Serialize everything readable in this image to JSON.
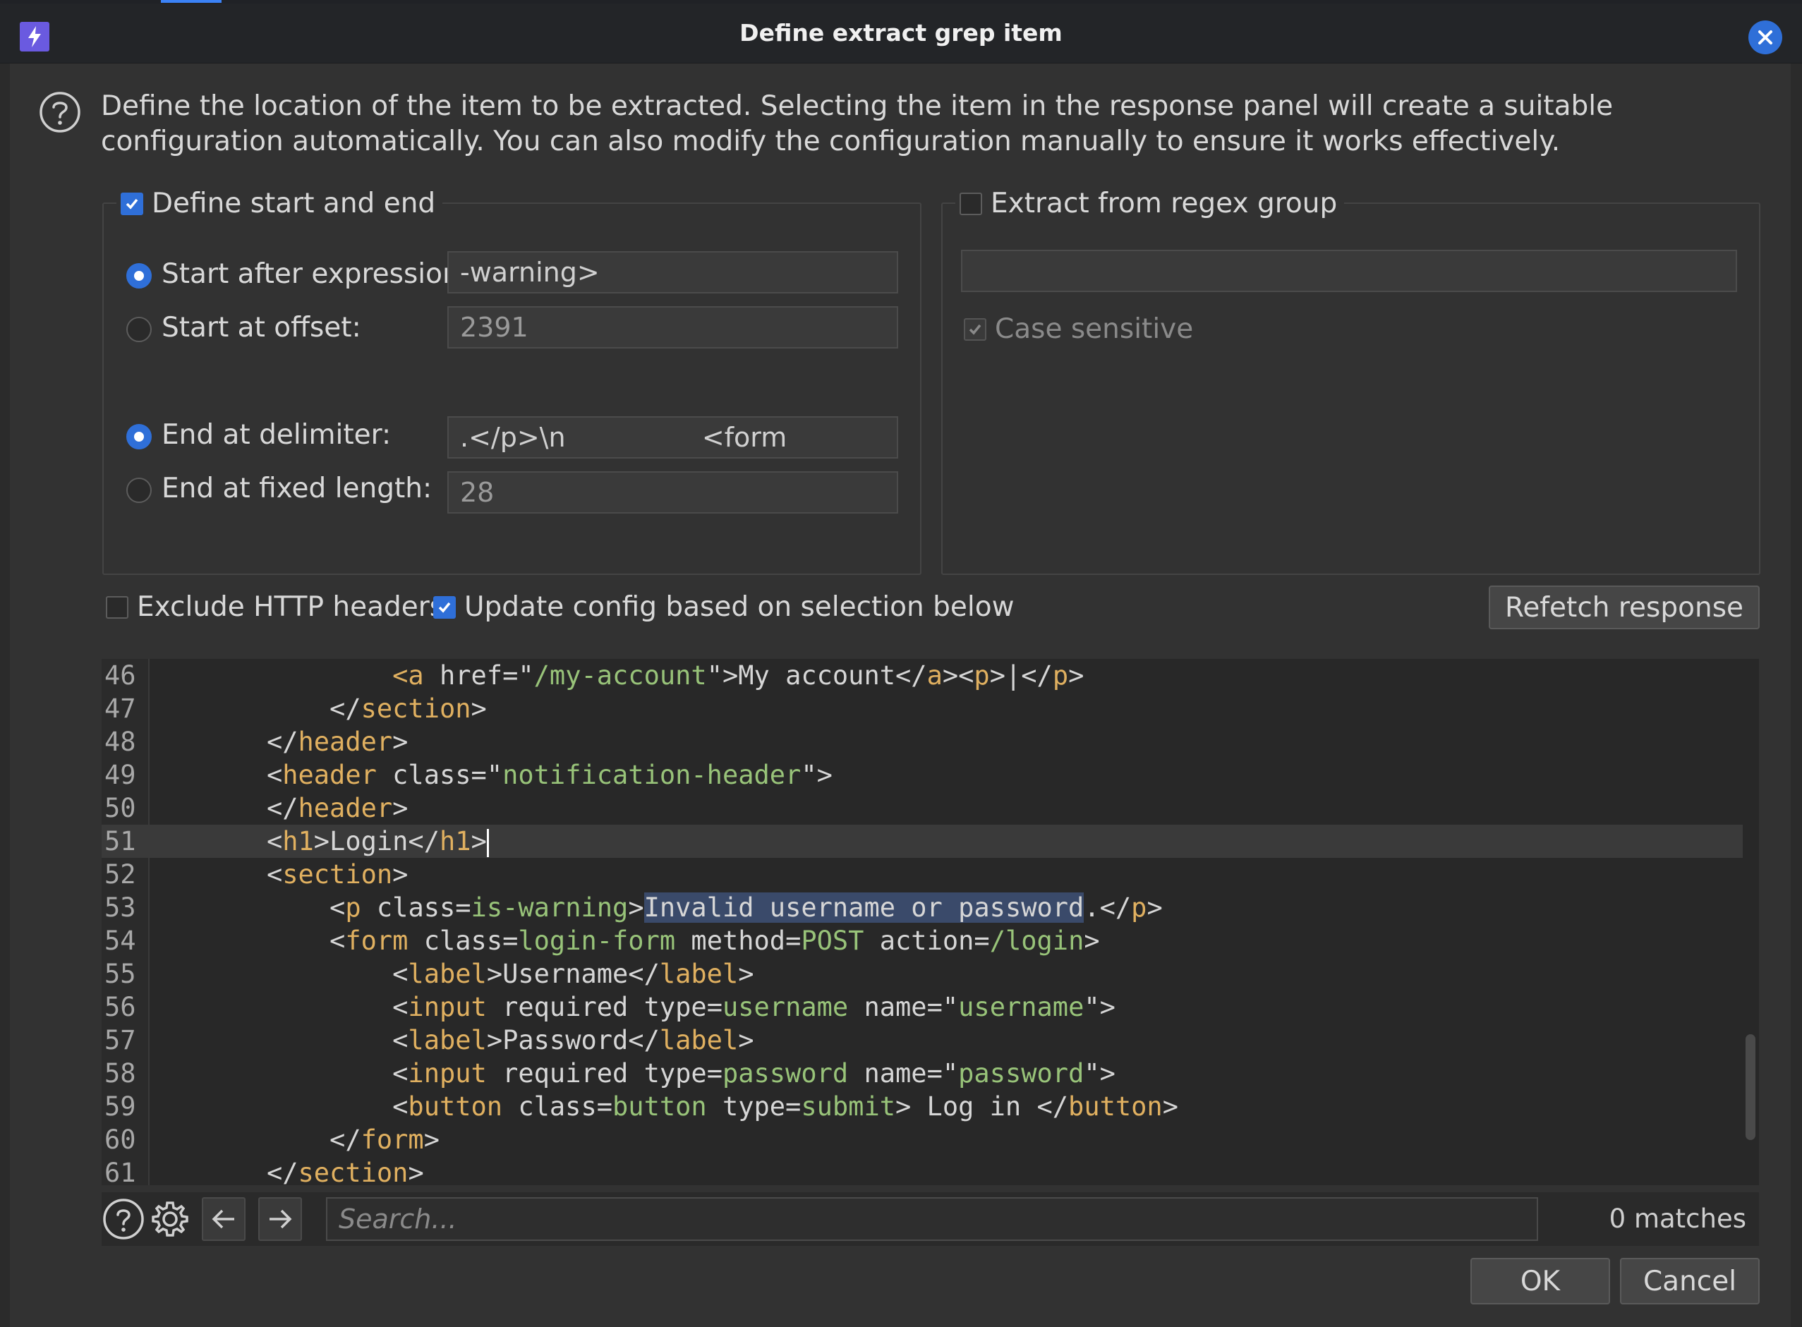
{
  "window": {
    "title": "Define extract grep item",
    "icon": "burp-lightning-icon"
  },
  "description": "Define the location of the item to be extracted. Selecting the item in the response panel will create a suitable configuration automatically. You can also modify the configuration manually to ensure it works effectively.",
  "start_end": {
    "legend": "Define start and end",
    "checked": true,
    "start_after_label": "Start after expression:",
    "start_after_value": "-warning>",
    "start_offset_label": "Start at offset:",
    "start_offset_value": "2391",
    "end_delim_label": "End at delimiter:",
    "end_delim_value": ".</p>\\n                <form",
    "end_fixed_label": "End at fixed length:",
    "end_fixed_value": "28"
  },
  "regex": {
    "legend": "Extract from regex group",
    "checked": false,
    "value": "",
    "case_sensitive_label": "Case sensitive"
  },
  "options": {
    "exclude_headers_label": "Exclude HTTP headers",
    "update_config_label": "Update config based on selection below",
    "refetch_label": "Refetch response"
  },
  "code_lines": [
    {
      "num": "46"
    },
    {
      "num": "47"
    },
    {
      "num": "48"
    },
    {
      "num": "49"
    },
    {
      "num": "50"
    },
    {
      "num": "51"
    },
    {
      "num": "52"
    },
    {
      "num": "53"
    },
    {
      "num": "54"
    },
    {
      "num": "55"
    },
    {
      "num": "56"
    },
    {
      "num": "57"
    },
    {
      "num": "58"
    },
    {
      "num": "59"
    },
    {
      "num": "60"
    },
    {
      "num": "61"
    }
  ],
  "search": {
    "placeholder": "Search...",
    "matches": "0 matches"
  },
  "buttons": {
    "ok": "OK",
    "cancel": "Cancel"
  },
  "colors": {
    "accent": "#2f6fd8",
    "tag": "#e0b060",
    "string": "#98c379"
  }
}
